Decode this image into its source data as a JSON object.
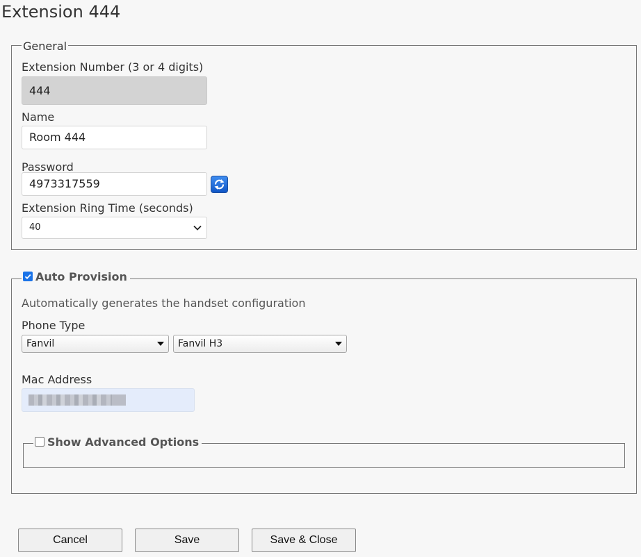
{
  "page": {
    "title": "Extension 444"
  },
  "general": {
    "legend": "General",
    "ext_number_label": "Extension Number (3 or 4 digits)",
    "ext_number_value": "444",
    "name_label": "Name",
    "name_value": "Room 444",
    "password_label": "Password",
    "password_value": "4973317559",
    "ring_time_label": "Extension Ring Time (seconds)",
    "ring_time_value": "40"
  },
  "auto_provision": {
    "legend": "Auto Provision",
    "checked": true,
    "description": "Automatically generates the handset configuration",
    "phone_type_label": "Phone Type",
    "phone_brand_value": "Fanvil",
    "phone_model_value": "Fanvil H3",
    "mac_label": "Mac Address",
    "mac_value_redacted": true
  },
  "advanced": {
    "legend": "Show Advanced Options",
    "checked": false
  },
  "buttons": {
    "cancel": "Cancel",
    "save": "Save",
    "save_close": "Save & Close"
  },
  "icons": {
    "refresh": "refresh-icon",
    "chevron": "chevron-down-icon"
  },
  "colors": {
    "accent": "#1a73e8",
    "disabled_field": "#d3d3d3",
    "mac_field": "#e4ecfb"
  }
}
